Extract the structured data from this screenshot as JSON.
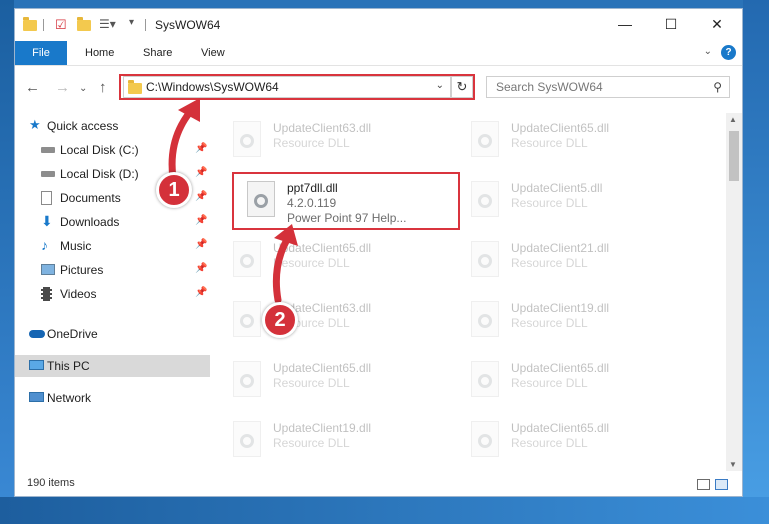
{
  "window": {
    "title": "SysWOW64",
    "minimize": "—",
    "maximize": "☐",
    "close": "✕"
  },
  "ribbon": {
    "tabs": [
      "File",
      "Home",
      "Share",
      "View"
    ],
    "help": "?"
  },
  "address": {
    "path": "C:\\Windows\\SysWOW64",
    "search_placeholder": "Search SysWOW64"
  },
  "sidebar": {
    "quick_access": "Quick access",
    "items": [
      {
        "label": "Local Disk (C:)",
        "icon": "drive-icon"
      },
      {
        "label": "Local Disk (D:)",
        "icon": "drive-icon"
      },
      {
        "label": "Documents",
        "icon": "documents-icon"
      },
      {
        "label": "Downloads",
        "icon": "downloads-icon"
      },
      {
        "label": "Music",
        "icon": "music-icon"
      },
      {
        "label": "Pictures",
        "icon": "pictures-icon"
      },
      {
        "label": "Videos",
        "icon": "videos-icon"
      }
    ],
    "onedrive": "OneDrive",
    "this_pc": "This PC",
    "network": "Network"
  },
  "files": {
    "highlighted": {
      "name": "ppt7dll.dll",
      "version": "4.2.0.119",
      "description": "Power Point 97 Help..."
    },
    "left_column": [
      {
        "name": "UpdateClient63.dll",
        "type": "Resource DLL"
      },
      {
        "name": "UpdateClient65.dll",
        "type": "Resource DLL"
      },
      {
        "name": "UpdateClient63.dll",
        "type": "Resource DLL"
      },
      {
        "name": "UpdateClient65.dll",
        "type": "Resource DLL"
      },
      {
        "name": "UpdateClient19.dll",
        "type": "Resource DLL"
      }
    ],
    "right_column": [
      {
        "name": "UpdateClient65.dll",
        "type": "Resource DLL"
      },
      {
        "name": "UpdateClient5.dll",
        "type": "Resource DLL"
      },
      {
        "name": "UpdateClient21.dll",
        "type": "Resource DLL"
      },
      {
        "name": "UpdateClient19.dll",
        "type": "Resource DLL"
      },
      {
        "name": "UpdateClient65.dll",
        "type": "Resource DLL"
      },
      {
        "name": "UpdateClient65.dll",
        "type": "Resource DLL"
      }
    ]
  },
  "status": {
    "item_count": "190 items"
  },
  "annotations": {
    "step1": "1",
    "step2": "2",
    "color": "#d4313a"
  }
}
